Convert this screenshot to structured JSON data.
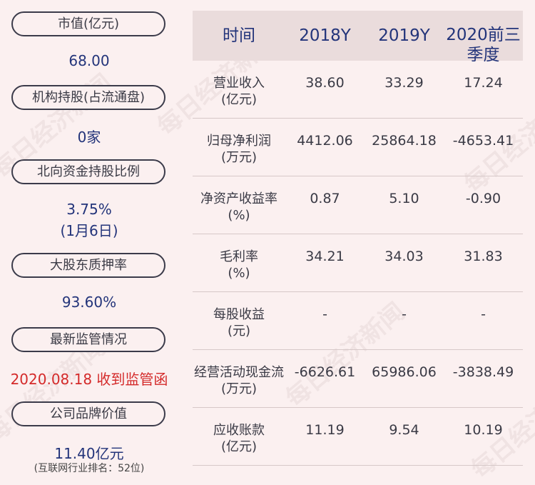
{
  "left": {
    "market_cap_label": "市值(亿元)",
    "market_cap_value": "68.00",
    "inst_label": "机构持股(占流通盘)",
    "inst_value": "0家",
    "north_label": "北向资金持股比例",
    "north_value": "3.75%",
    "north_date": "(1月6日)",
    "pledge_label": "大股东质押率",
    "pledge_value": "93.60%",
    "reg_label": "最新监管情况",
    "reg_value": "2020.08.18 收到监管函",
    "brand_label": "公司品牌价值",
    "brand_value": "11.40亿元",
    "brand_rank": "(互联网行业排名：52位)"
  },
  "table": {
    "headers": [
      "时间",
      "2018Y",
      "2019Y",
      "2020前三季度"
    ],
    "rows": [
      {
        "label1": "营业收入",
        "label2": "(亿元)",
        "v2018": "38.60",
        "v2019": "33.29",
        "v2020": "17.24"
      },
      {
        "label1": "归母净利润",
        "label2": "(万元)",
        "v2018": "4412.06",
        "v2019": "25864.18",
        "v2020": "-4653.41"
      },
      {
        "label1": "净资产收益率",
        "label2": "(%)",
        "v2018": "0.87",
        "v2019": "5.10",
        "v2020": "-0.90"
      },
      {
        "label1": "毛利率",
        "label2": "(%)",
        "v2018": "34.21",
        "v2019": "34.03",
        "v2020": "31.83"
      },
      {
        "label1": "每股收益",
        "label2": "(元)",
        "v2018": "-",
        "v2019": "-",
        "v2020": "-"
      },
      {
        "label1": "经营活动现金流",
        "label2": "(万元)",
        "v2018": "-6626.61",
        "v2019": "65986.06",
        "v2020": "-3838.49"
      },
      {
        "label1": "应收账款",
        "label2": "(亿元)",
        "v2018": "11.19",
        "v2019": "9.54",
        "v2020": "10.19"
      }
    ]
  },
  "watermark": "每日经济新闻"
}
